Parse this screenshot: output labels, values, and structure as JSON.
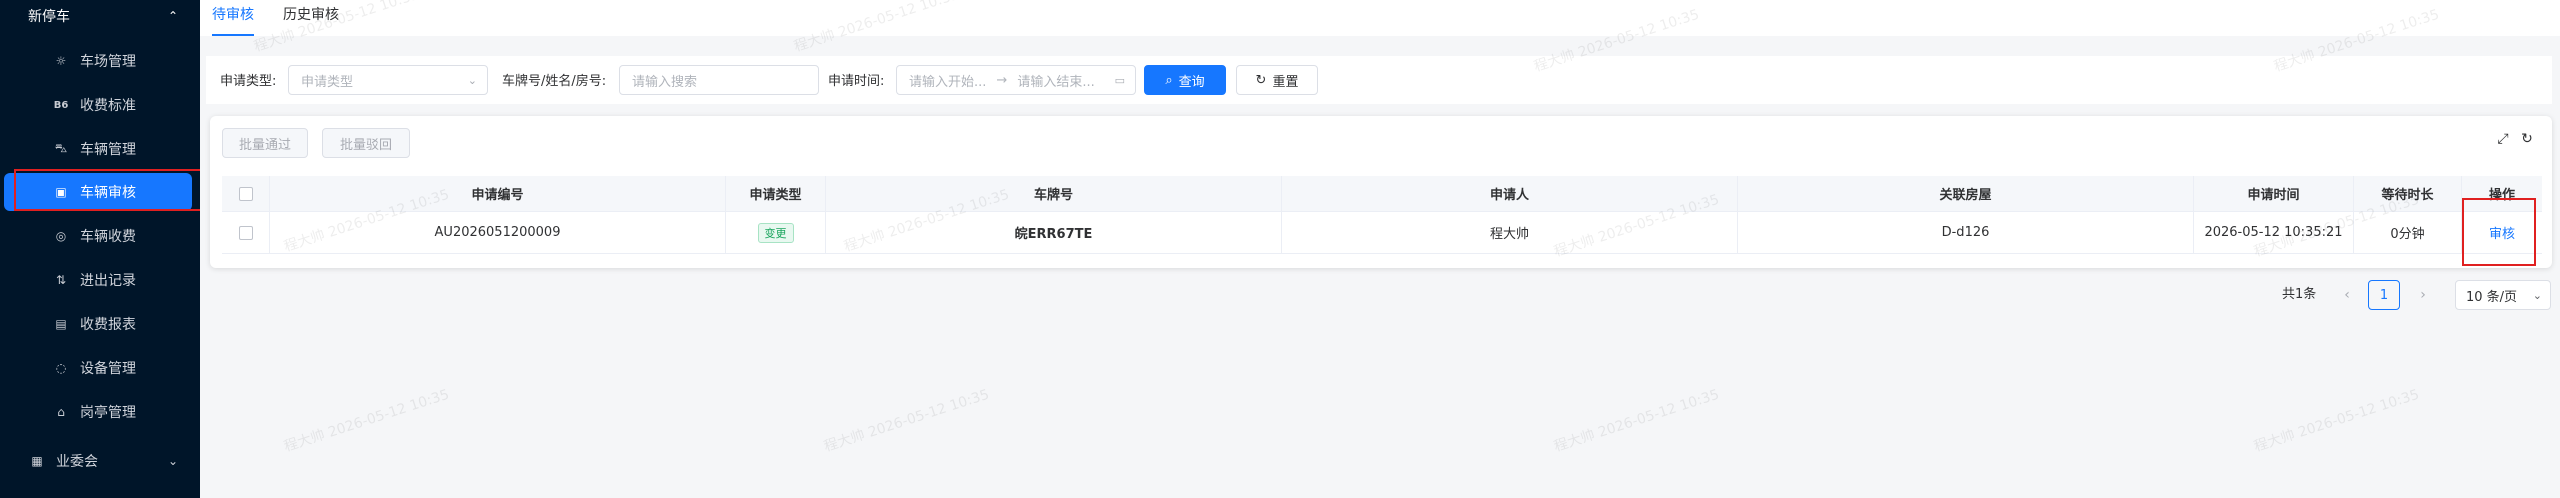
{
  "sidebar": {
    "group_title": "新停车",
    "items": [
      {
        "label": "车场管理",
        "icon": "bulb-icon"
      },
      {
        "label": "收费标准",
        "icon": "b6-icon"
      },
      {
        "label": "车辆管理",
        "icon": "car-icon"
      },
      {
        "label": "车辆审核",
        "icon": "audit-icon"
      },
      {
        "label": "车辆收费",
        "icon": "coin-icon"
      },
      {
        "label": "进出记录",
        "icon": "record-icon"
      },
      {
        "label": "收费报表",
        "icon": "report-icon"
      },
      {
        "label": "设备管理",
        "icon": "device-icon"
      },
      {
        "label": "岗亭管理",
        "icon": "booth-icon"
      }
    ],
    "active_index": 3,
    "bottom_group": "业委会"
  },
  "tabs": [
    "待审核",
    "历史审核"
  ],
  "filters": {
    "type_label": "申请类型:",
    "type_placeholder": "申请类型",
    "plate_label": "车牌号/姓名/房号:",
    "plate_placeholder": "请输入搜索",
    "time_label": "申请时间:",
    "start_placeholder": "请输入开始...",
    "range_sep": "→",
    "end_placeholder": "请输入结束...",
    "search_button": "查询",
    "reset_button": "重置"
  },
  "toolbar": {
    "batch_approve": "批量通过",
    "batch_reject": "批量驳回"
  },
  "table": {
    "columns": [
      "申请编号",
      "申请类型",
      "车牌号",
      "申请人",
      "关联房屋",
      "申请时间",
      "等待时长",
      "操作"
    ],
    "rows": [
      {
        "id": "AU2026051200009",
        "type": "变更",
        "plate": "皖ERR67TE",
        "applicant": "程大帅",
        "house": "D-d126",
        "time": "2026-05-12 10:35:21",
        "wait": "0分钟",
        "action": "审核"
      }
    ]
  },
  "pagination": {
    "total": "共1条",
    "current": "1",
    "page_size": "10 条/页"
  },
  "watermark": "程大帅 2026-05-12 10:35"
}
